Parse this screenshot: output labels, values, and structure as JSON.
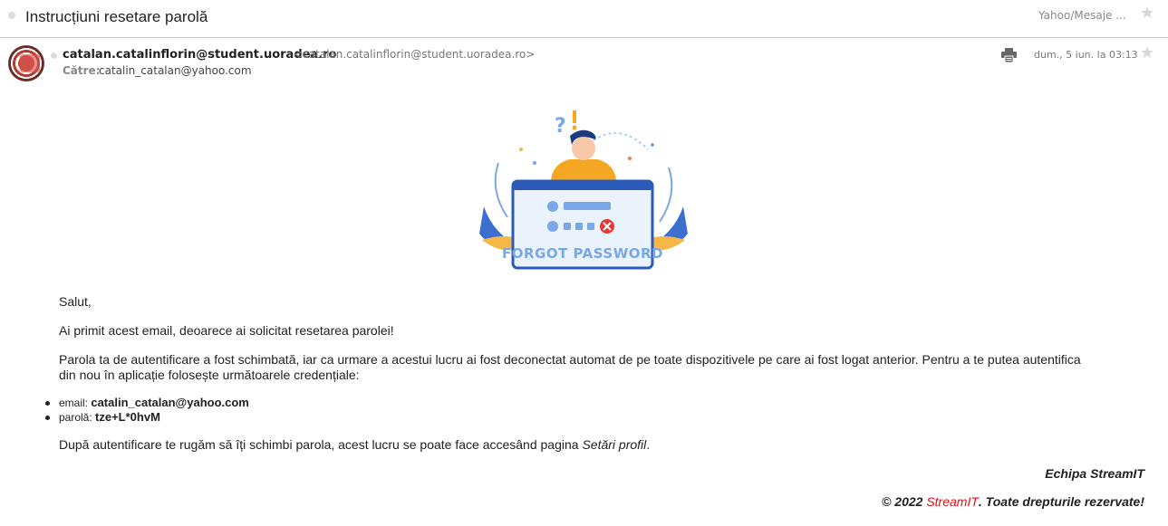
{
  "header": {
    "subject": "Instrucțiuni resetare parolă",
    "folder": "Yahoo/Mesaje ...",
    "star_icon": "star-icon"
  },
  "message": {
    "sender_name": "catalan.catalinflorin@student.uoradea.ro",
    "sender_email": "<catalan.catalinflorin@student.uoradea.ro>",
    "to_label": "Către:",
    "to_value": "catalin_catalan@yahoo.com",
    "date": "dum., 5 iun. la 03:13",
    "print_icon": "printer-icon",
    "avatar_icon": "avatar"
  },
  "illustration": {
    "banner_text": "FORGOT PASSWORD"
  },
  "body": {
    "greeting": "Salut,",
    "line1": "Ai primit acest email, deoarece ai solicitat resetarea parolei!",
    "line2": "Parola ta de autentificare a fost schimbată, iar ca urmare a acestui lucru ai fost deconectat automat de pe toate dispozitivele pe care ai fost logat anterior. Pentru a te putea autentifica din nou în aplicație folosește următoarele credențiale:",
    "credentials": [
      {
        "label": "email: ",
        "value": "catalin_catalan@yahoo.com"
      },
      {
        "label": "parolă: ",
        "value": "tze+L*0hvM"
      }
    ],
    "line3_pre": "După autentificare te rugăm să îți schimbi parola, acest lucru se poate face accesând pagina ",
    "line3_link": "Setări profil",
    "line3_post": "."
  },
  "footer": {
    "signature": "Echipa StreamIT",
    "copyright_pre": "© 2022 ",
    "brand": "StreamIT",
    "copyright_post": ". Toate drepturile rezervate!",
    "brand_color": "#e50914"
  }
}
